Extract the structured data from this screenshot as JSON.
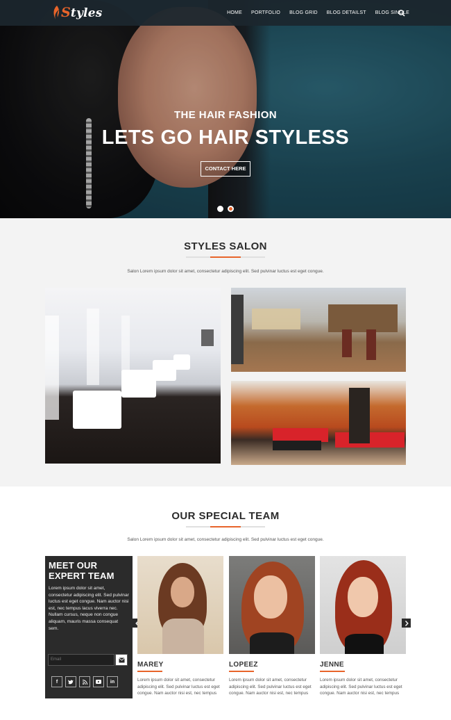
{
  "nav": {
    "logo_text": "Styles",
    "logo_initial": "S",
    "logo_rest": "tyles",
    "items": [
      "HOME",
      "PORTFOLIO",
      "BLOG GRID",
      "BLOG DETAILST",
      "BLOG SINGLE"
    ],
    "search_icon": "search-icon"
  },
  "hero": {
    "subtitle": "THE HAIR FASHION",
    "title": "LETS GO HAIR STYLESS",
    "button": "CONTACT HERE",
    "active_slide": 2,
    "slide_count": 2
  },
  "salon": {
    "title": "STYLES SALON",
    "description": "Salon Lorem ipsum dolor sit amet, consectetur adipiscing elit. Sed pulvinar luctus est eget congue."
  },
  "team": {
    "title": "OUR SPECIAL TEAM",
    "description": "Salon Lorem ipsum dolor sit amet, consectetur adipiscing elit. Sed pulvinar luctus est eget congue.",
    "meet": {
      "title_line1": "MEET OUR",
      "title_line2": "EXPERT TEAM",
      "text": "Lorem ipsum dolor sit amet, consectetur adipiscing elit. Sed pulvinar luctus est eget congue. Nam auctor nisi est, nec tempus lacus viverra nec. Nullam cursus, neque non congue aliquam, mauris massa consequat sem.",
      "email_placeholder": "Email",
      "socials": [
        "f",
        "t",
        "rss",
        "yt",
        "in"
      ]
    },
    "members": [
      {
        "name": "MAREY",
        "text": "Lorem ipsum dolor sit amet, consectetur adipiscing elit. Sed pulvinar luctus est eget congue. Nam auctor nisi est, nec tempus"
      },
      {
        "name": "LOPEEZ",
        "text": "Lorem ipsum dolor sit amet, consectetur adipiscing elit. Sed pulvinar luctus est eget congue. Nam auctor nisi est, nec tempus"
      },
      {
        "name": "JENNE",
        "text": "Lorem ipsum dolor sit amet, consectetur adipiscing elit. Sed pulvinar luctus est eget congue. Nam auctor nisi est, nec tempus"
      }
    ]
  },
  "colors": {
    "accent": "#e8642a",
    "nav_bg": "#1c262e",
    "dark_panel": "#2b2b2b",
    "section_bg": "#f3f3f3"
  }
}
